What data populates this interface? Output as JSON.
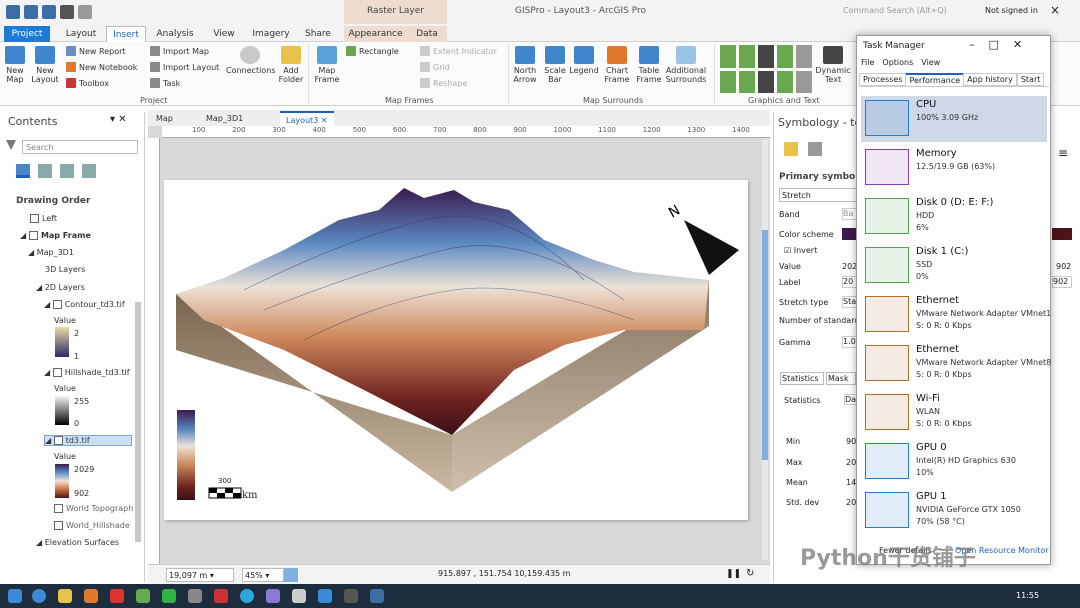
{
  "app": {
    "title": "GISPro - Layout3 - ArcGIS Pro",
    "context_tab": "Raster Layer",
    "search_placeholder": "Command Search (Alt+Q)",
    "signin": "Not signed in"
  },
  "tabs": [
    "Project",
    "Layout",
    "Insert",
    "Analysis",
    "View",
    "Imagery",
    "Share",
    "Appearance",
    "Data"
  ],
  "ribbon": {
    "project": {
      "new_map": "New Map",
      "new_layout": "New Layout",
      "new_report": "New Report",
      "new_notebook": "New Notebook",
      "toolbox": "Toolbox",
      "import_map": "Import Map",
      "import_layout": "Import Layout",
      "task": "Task",
      "connections": "Connections",
      "add_folder": "Add Folder",
      "group": "Project"
    },
    "map_frames": {
      "map_frame": "Map Frame",
      "rectangle": "Rectangle",
      "extent_indicator": "Extent Indicator",
      "grid": "Grid",
      "reshape": "Reshape",
      "group": "Map Frames"
    },
    "surrounds": {
      "north_arrow": "North Arrow",
      "scale_bar": "Scale Bar",
      "legend": "Legend",
      "chart_frame": "Chart Frame",
      "table_frame": "Table Frame",
      "additional": "Additional Surrounds",
      "group": "Map Surrounds"
    },
    "graphics": {
      "dynamic_text": "Dynamic Text",
      "group": "Graphics and Text"
    }
  },
  "contents": {
    "title": "Contents",
    "search_placeholder": "Search",
    "drawing_order": "Drawing Order",
    "items": {
      "left": "Left",
      "map_frame": "Map Frame",
      "map_3d1": "Map_3D1",
      "layers_3d": "3D Layers",
      "layers_2d": "2D Layers",
      "contour": "Contour_td3.tif",
      "value1": "Value",
      "c_hi": "2",
      "c_lo": "1",
      "hillshade": "Hillshade_td3.tif",
      "value2": "Value",
      "h_hi": "255",
      "h_lo": "0",
      "td3": "td3.tif",
      "value3": "Value",
      "t_hi": "2029",
      "t_lo": "902",
      "world_topo": "World Topograph",
      "world_hill": "World_Hillshade",
      "elev": "Elevation Surfaces"
    }
  },
  "view_tabs": [
    "Map",
    "Map_3D1",
    "Layout3"
  ],
  "ruler_h": [
    "100",
    "200",
    "300",
    "400",
    "500",
    "600",
    "700",
    "800",
    "900",
    "1000",
    "1100",
    "1200",
    "1300",
    "1400"
  ],
  "ruler_v": [
    "600",
    "700",
    "800",
    "900",
    "500",
    "400",
    "300",
    "200",
    "100"
  ],
  "layout": {
    "scale_value": "300",
    "scale_unit": "km"
  },
  "status": {
    "scale": "19,097 m",
    "zoom": "45%",
    "coords": "915.897 , 151.754  10,159.435 m"
  },
  "symbology": {
    "title": "Symbology - td",
    "primary": "Primary symbol",
    "renderer": "Stretch",
    "band": "Band",
    "band_val": "Ba",
    "color_scheme": "Color scheme",
    "invert": "Invert",
    "value": "Value",
    "value_val": "202",
    "value_r": "902",
    "label": "Label",
    "label_val": "20",
    "label_r": "902",
    "stretch_type": "Stretch type",
    "stretch_val": "Sta",
    "num_std": "Number of standard",
    "gamma": "Gamma",
    "gamma_val": "1.0",
    "tab_stats": "Statistics",
    "tab_mask": "Mask",
    "statistics": "Statistics",
    "stat_val": "Da",
    "min": "Min",
    "min_val": "90",
    "max": "Max",
    "max_val": "20",
    "mean": "Mean",
    "mean_val": "14",
    "std": "Std. dev",
    "std_val": "20"
  },
  "task_manager": {
    "title": "Task Manager",
    "menu": [
      "File",
      "Options",
      "View"
    ],
    "tabs": [
      "Processes",
      "Performance",
      "App history",
      "Start"
    ],
    "rows": [
      {
        "name": "CPU",
        "s1": "100% 3.09 GHz",
        "s2": "",
        "color": "#1f7fd4"
      },
      {
        "name": "Memory",
        "s1": "12.5/19.9 GB (63%)",
        "s2": "",
        "color": "#8b3ea8"
      },
      {
        "name": "Disk 0 (D: E: F:)",
        "s1": "HDD",
        "s2": "6%",
        "color": "#4aa84a"
      },
      {
        "name": "Disk 1 (C:)",
        "s1": "SSD",
        "s2": "0%",
        "color": "#4aa84a"
      },
      {
        "name": "Ethernet",
        "s1": "VMware Network Adapter VMnet1",
        "s2": "S: 0  R: 0 Kbps",
        "color": "#b56c28"
      },
      {
        "name": "Ethernet",
        "s1": "VMware Network Adapter VMnet8",
        "s2": "S: 0  R: 0 Kbps",
        "color": "#b56c28"
      },
      {
        "name": "Wi-Fi",
        "s1": "WLAN",
        "s2": "S: 0  R: 0 Kbps",
        "color": "#b56c28"
      },
      {
        "name": "GPU 0",
        "s1": "Intel(R) HD Graphics 630",
        "s2": "10%",
        "color": "#1f7fd4"
      },
      {
        "name": "GPU 1",
        "s1": "NVIDIA GeForce GTX 1050",
        "s2": "70% (58 °C)",
        "color": "#1f7fd4"
      }
    ],
    "footer_less": "Fewer details",
    "footer_open": "Open Resource Monitor"
  },
  "watermark": "Python干货铺子",
  "taskbar": {
    "time": "11:55"
  }
}
